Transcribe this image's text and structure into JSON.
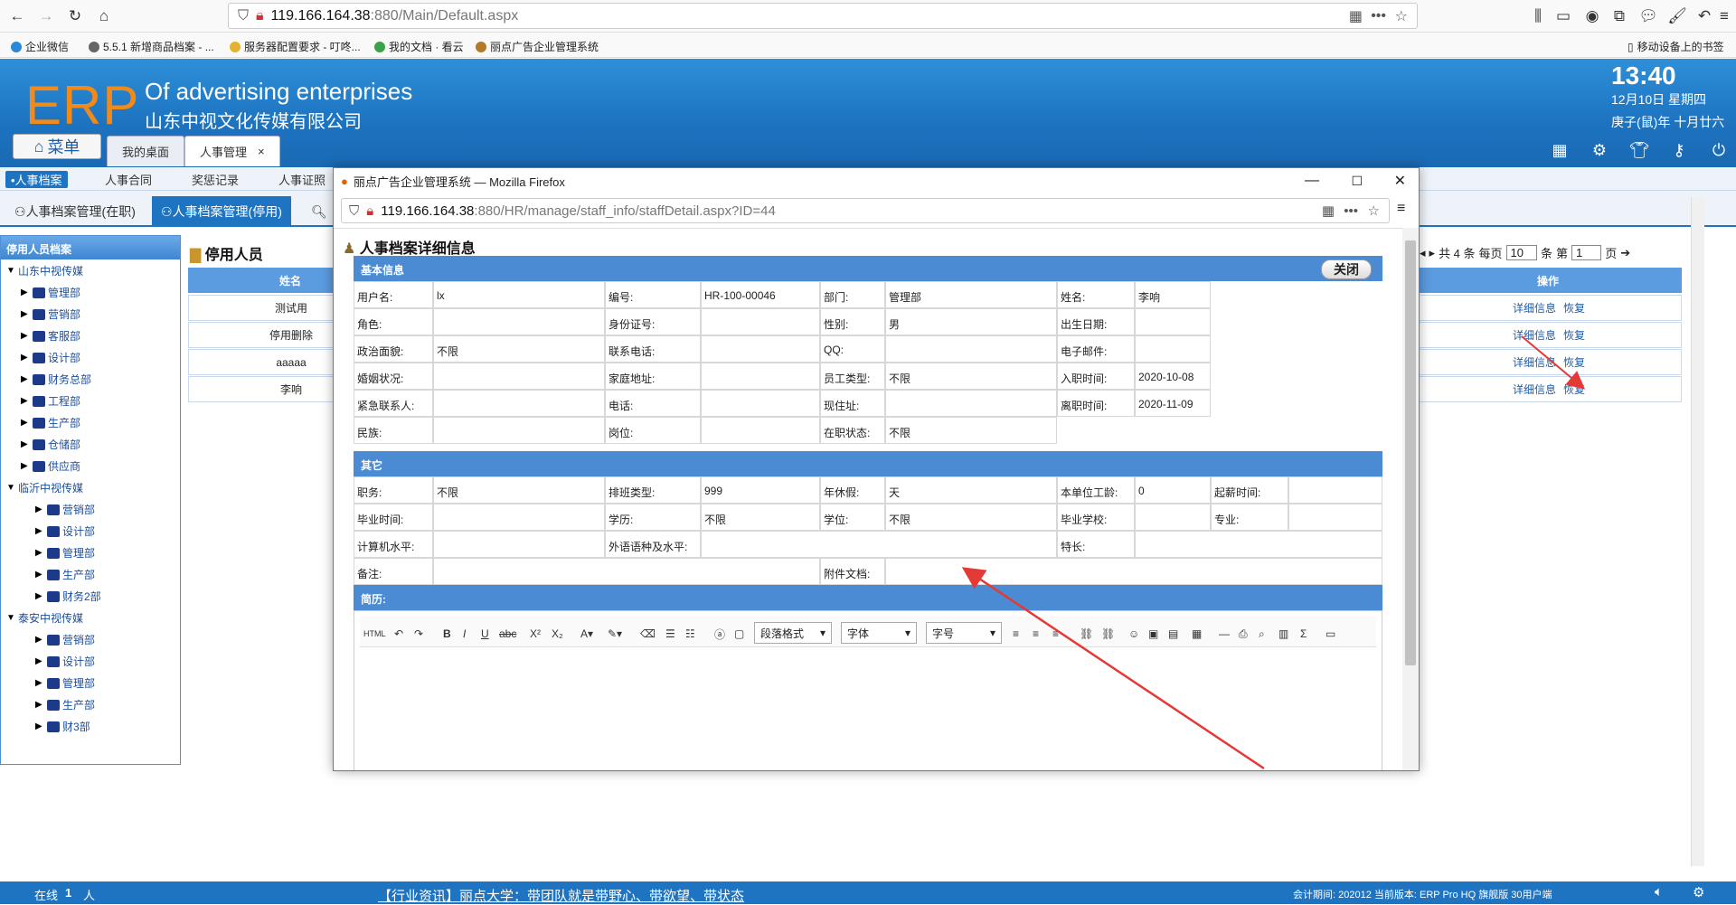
{
  "browser": {
    "url_host": "119.166.164.38",
    "url_rest": ":880/Main/Default.aspx",
    "bookmarks": [
      {
        "label": "企业微信",
        "color": "#2b87d8"
      },
      {
        "label": "5.5.1 新增商品档案 - ...",
        "color": "#666"
      },
      {
        "label": "服务器配置要求 - 叮咚...",
        "color": "#e4b22d"
      },
      {
        "label": "我的文档 · 看云",
        "color": "#3aa34a"
      },
      {
        "label": "丽点广告企业管理系统",
        "color": "#b37a2a"
      }
    ],
    "mobile_bookmarks": "移动设备上的书签"
  },
  "header": {
    "logo": "ERP",
    "subtitle_en": "Of advertising enterprises",
    "subtitle_cn": "山东中视文化传媒有限公司",
    "time": "13:40",
    "date1": "12月10日 星期四",
    "date2": "庚子(鼠)年 十月廿六",
    "menu_label": "菜单",
    "tabs": [
      {
        "label": "我的桌面"
      },
      {
        "label": "人事管理"
      }
    ],
    "tab_close": "×"
  },
  "subnav": {
    "items": [
      "•人事档案",
      "人事合同",
      "奖惩记录",
      "人事证照"
    ]
  },
  "subtabs": {
    "items": [
      "人事档案管理(在职)",
      "人事档案管理(停用)"
    ]
  },
  "tree": {
    "title": "停用人员档案",
    "nodes": [
      {
        "label": "山东中视传媒",
        "level": 0
      },
      {
        "label": "管理部",
        "level": 1
      },
      {
        "label": "营销部",
        "level": 1
      },
      {
        "label": "客服部",
        "level": 1
      },
      {
        "label": "设计部",
        "level": 1
      },
      {
        "label": "财务总部",
        "level": 1
      },
      {
        "label": "工程部",
        "level": 1
      },
      {
        "label": "生产部",
        "level": 1
      },
      {
        "label": "仓储部",
        "level": 1
      },
      {
        "label": "供应商",
        "level": 1
      },
      {
        "label": "临沂中视传媒",
        "level": 0
      },
      {
        "label": "营销部",
        "level": 2
      },
      {
        "label": "设计部",
        "level": 2
      },
      {
        "label": "管理部",
        "level": 2
      },
      {
        "label": "生产部",
        "level": 2
      },
      {
        "label": "财务2部",
        "level": 2
      },
      {
        "label": "泰安中视传媒",
        "level": 0
      },
      {
        "label": "营销部",
        "level": 2
      },
      {
        "label": "设计部",
        "level": 2
      },
      {
        "label": "管理部",
        "level": 2
      },
      {
        "label": "生产部",
        "level": 2
      },
      {
        "label": "财3部",
        "level": 2
      }
    ]
  },
  "main": {
    "title": "停用人员",
    "col_name": "姓名",
    "col_op": "操作",
    "rows": [
      "测试用",
      "停用删除",
      "aaaaa",
      "李响"
    ],
    "op_detail": "详细信息",
    "op_restore": "恢复",
    "pager": {
      "total": "共 4 条",
      "per_page_label": "每页",
      "per_page": "10",
      "unit": "条",
      "page_label": "第",
      "page": "1",
      "page_unit": "页"
    }
  },
  "popup": {
    "title": "丽点广告企业管理系统 — Mozilla Firefox",
    "url_host": "119.166.164.38",
    "url_rest": ":880/HR/manage/staff_info/staffDetail.aspx?ID=44",
    "heading": "人事档案详细信息",
    "close": "关闭",
    "section_basic": "基本信息",
    "section_other": "其它",
    "section_resume": "简历:",
    "basic": [
      [
        "用户名:",
        "lx",
        "编号:",
        "HR-100-00046",
        "部门:",
        "管理部",
        "姓名:",
        "李响"
      ],
      [
        "角色:",
        "",
        "身份证号:",
        "",
        "性别:",
        "男",
        "出生日期:",
        ""
      ],
      [
        "政治面貌:",
        "不限",
        "联系电话:",
        "",
        "QQ:",
        "",
        "电子邮件:",
        ""
      ],
      [
        "婚姻状况:",
        "",
        "家庭地址:",
        "",
        "员工类型:",
        "不限",
        "入职时间:",
        "2020-10-08"
      ],
      [
        "紧急联系人:",
        "",
        "电话:",
        "",
        "现住址:",
        "",
        "离职时间:",
        "2020-11-09"
      ],
      [
        "民族:",
        "",
        "岗位:",
        "",
        "在职状态:",
        "不限",
        "",
        ""
      ]
    ],
    "other": [
      [
        "职务:",
        "不限",
        "排班类型:",
        "999",
        "年休假:",
        "天",
        "本单位工龄:",
        "0",
        "起薪时间:",
        ""
      ],
      [
        "毕业时间:",
        "",
        "学历:",
        "不限",
        "学位:",
        "不限",
        "毕业学校:",
        "",
        "专业:",
        ""
      ]
    ],
    "skills": {
      "computer": "计算机水平:",
      "language": "外语语种及水平:",
      "specialty": "特长:",
      "remark": "备注:",
      "attachment": "附件文档:"
    },
    "editor": {
      "para": "段落格式",
      "font": "字体",
      "size": "字号"
    }
  },
  "status": {
    "online_label": "在线",
    "online_count": "1",
    "online_unit": "人",
    "news": "【行业资讯】丽点大学：带团队就是带野心、带欲望、带状态",
    "info": "会计期间: 202012 当前版本: ERP Pro HQ 旗舰版 30用户端"
  },
  "colors": {
    "header": "#1d73c0",
    "logo": "#f28a1b",
    "section": "#4a8bd3",
    "arrow": "#e53935"
  }
}
